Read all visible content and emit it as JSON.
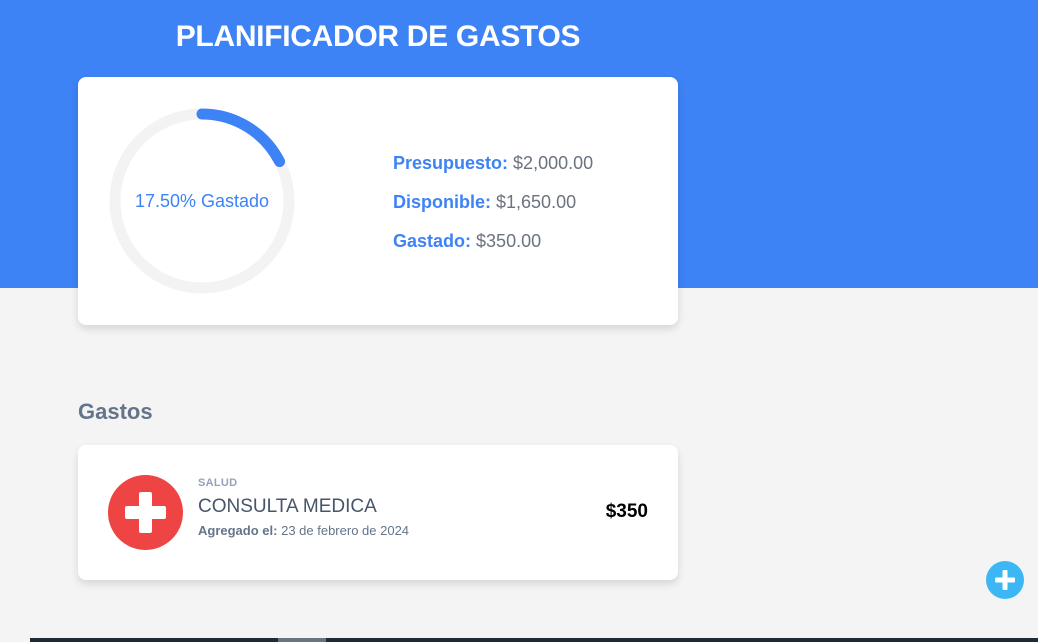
{
  "header": {
    "title": "PLANIFICADOR DE GASTOS",
    "background_color": "#3d83f5"
  },
  "budget": {
    "progress_percent": 17.5,
    "progress_text": "17.50% Gastado",
    "presupuesto_label": "Presupuesto:",
    "presupuesto_value": "$2,000.00",
    "disponible_label": "Disponible:",
    "disponible_value": "$1,650.00",
    "gastado_label": "Gastado:",
    "gastado_value": "$350.00"
  },
  "expenses": {
    "section_title": "Gastos",
    "items": [
      {
        "category": "SALUD",
        "icon": "medical-cross-icon",
        "icon_color": "#ef4444",
        "name": "CONSULTA MEDICA",
        "date_label": "Agregado el:",
        "date_value": "23 de febrero de 2024",
        "amount": "$350"
      }
    ]
  },
  "actions": {
    "add_icon": "plus-icon",
    "add_color": "#3bb7f5"
  }
}
